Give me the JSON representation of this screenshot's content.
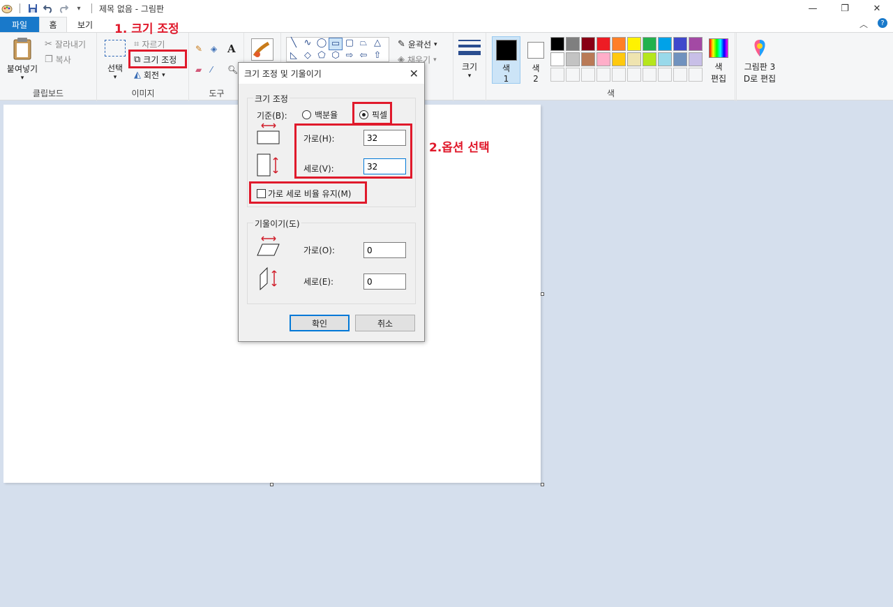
{
  "window": {
    "title": "제목 없음 - 그림판",
    "qa_icons": [
      "paint-app-icon",
      "save-icon",
      "undo-icon",
      "redo-icon",
      "customize-icon"
    ],
    "controls": [
      "minimize-icon",
      "restore-icon",
      "close-icon"
    ]
  },
  "tabs": [
    {
      "label": "파일"
    },
    {
      "label": "홈"
    },
    {
      "label": "보기"
    }
  ],
  "ribbon": {
    "clipboard": {
      "group_label": "클립보드",
      "paste": "붙여넣기",
      "cut": "잘라내기",
      "copy": "복사"
    },
    "image": {
      "group_label": "이미지",
      "select": "선택",
      "crop": "자르기",
      "resize": "크기 조정",
      "rotate": "회전"
    },
    "tools": {
      "group_label": "도구"
    },
    "shapes": {
      "outline": "윤곽선",
      "fill": "채우기"
    },
    "size": {
      "label": "크기"
    },
    "colors": {
      "group_label": "색",
      "color1_label": "색",
      "color1_num": "1",
      "color2_label": "색",
      "color2_num": "2",
      "edit_colors_line1": "색",
      "edit_colors_line2": "편집",
      "paint3d_line1": "그림판 3",
      "paint3d_line2": "D로 편집",
      "color1_value": "#000000",
      "color2_value": "#ffffff",
      "palette_row1": [
        "#000000",
        "#7f7f7f",
        "#880015",
        "#ed1c24",
        "#ff7f27",
        "#fff200",
        "#22b14c",
        "#00a2e8",
        "#3f48cc",
        "#a349a4"
      ],
      "palette_row2": [
        "#ffffff",
        "#c3c3c3",
        "#b97a57",
        "#ffaec9",
        "#ffc90e",
        "#efe4b0",
        "#b5e61d",
        "#99d9ea",
        "#7092be",
        "#c8bfe7"
      ],
      "palette_row3": [
        "#f5f6f7",
        "#f5f6f7",
        "#f5f6f7",
        "#f5f6f7",
        "#f5f6f7",
        "#f5f6f7",
        "#f5f6f7",
        "#f5f6f7",
        "#f5f6f7",
        "#f5f6f7"
      ]
    }
  },
  "dialog": {
    "title": "크기 조정 및 기울이기",
    "resize": {
      "legend": "크기 조정",
      "basis_label": "기준(B):",
      "percent_label": "백분율",
      "pixel_label": "픽셀",
      "selected": "pixel",
      "horizontal_label": "가로(H):",
      "horizontal_value": "32",
      "vertical_label": "세로(V):",
      "vertical_value": "32",
      "keep_ratio_label": "가로 세로 비율 유지(M)",
      "keep_ratio_checked": false
    },
    "skew": {
      "legend": "기울이기(도)",
      "horizontal_label": "가로(O):",
      "horizontal_value": "0",
      "vertical_label": "세로(E):",
      "vertical_value": "0"
    },
    "ok_label": "확인",
    "cancel_label": "취소"
  },
  "annotations": {
    "step1": "1. 크기 조정",
    "step2": "2.옵션 선택"
  }
}
